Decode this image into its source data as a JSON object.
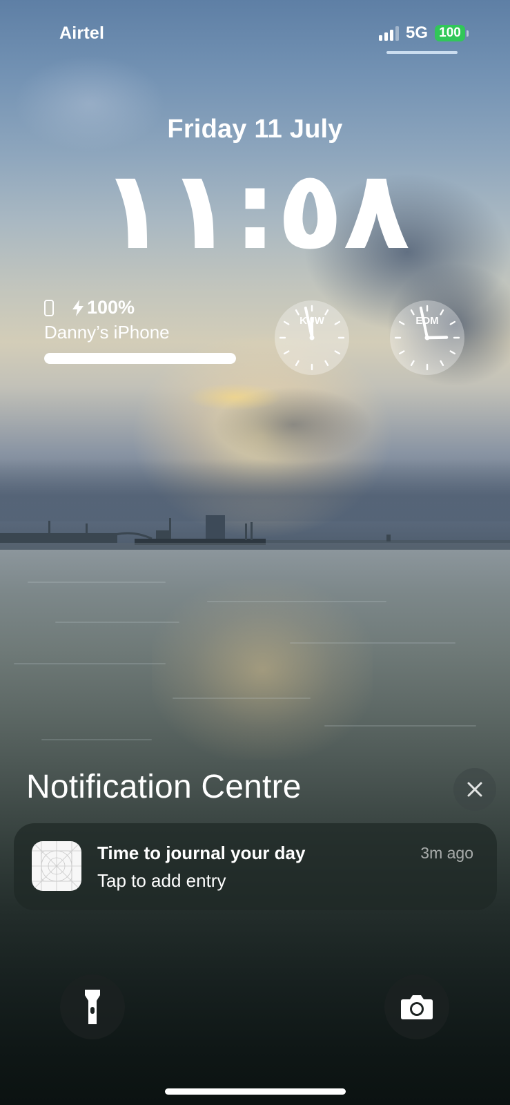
{
  "status_bar": {
    "carrier": "Airtel",
    "network": "5G",
    "battery_level": "100",
    "signal_bars_active": 3,
    "signal_bars_total": 4,
    "battery_color": "#31c759"
  },
  "lock_screen": {
    "date": "Friday 11 July",
    "time": "١١:٥٨"
  },
  "battery_widget": {
    "device_icon": "iphone-icon",
    "charging_icon": "bolt-icon",
    "percent_text": "100%",
    "device_name": "Danny’s iPhone",
    "level": 1.0
  },
  "world_clocks": [
    {
      "label": "KUW",
      "hour": 11,
      "minute": 58
    },
    {
      "label": "EDM",
      "hour": 2,
      "minute": 58
    }
  ],
  "notification_centre": {
    "title": "Notification Centre",
    "close_icon": "close-icon",
    "notifications": [
      {
        "app_icon": "placeholder-app-icon",
        "title": "Time to journal your day",
        "body": "Tap to add entry",
        "time": "3m ago"
      }
    ]
  },
  "bottom_controls": {
    "left_icon": "flashlight-icon",
    "right_icon": "camera-icon"
  }
}
